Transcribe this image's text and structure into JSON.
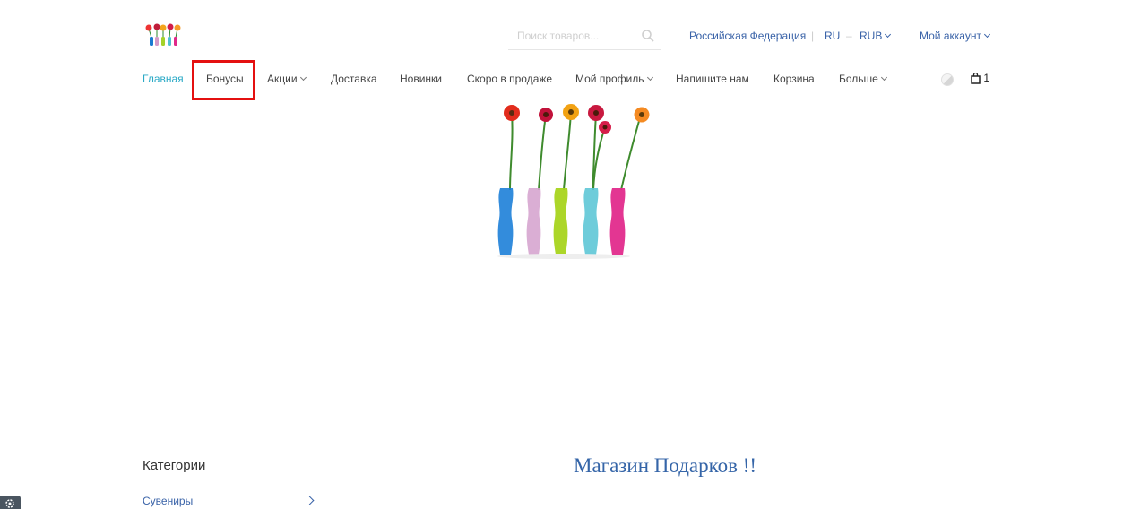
{
  "logo": {
    "icon": "flower-vases-logo-icon"
  },
  "search": {
    "placeholder": "Поиск товаров..."
  },
  "topnav": {
    "region": "Российская Федерация",
    "separator": "|",
    "language": "RU",
    "dash": "–",
    "currency": "RUB",
    "account": "Мой аккаунт"
  },
  "mainnav": {
    "items": [
      {
        "label": "Главная",
        "active": true
      },
      {
        "label": "Бонусы"
      },
      {
        "label": "Акции",
        "dropdown": true
      },
      {
        "label": "Доставка"
      },
      {
        "label": "Новинки"
      },
      {
        "label": "Скоро в продаже"
      },
      {
        "label": "Мой профиль",
        "dropdown": true
      },
      {
        "label": "Напишите нам"
      },
      {
        "label": "Корзина"
      },
      {
        "label": "Больше",
        "dropdown": true
      }
    ]
  },
  "cart": {
    "count": "1",
    "icon": "shopping-bag-icon"
  },
  "colors": {
    "accent": "#2aa9c6",
    "link": "#3a63a8",
    "highlight": "#e41010",
    "title": "#3565a8"
  },
  "categories": {
    "title": "Категории",
    "items": [
      {
        "label": "Сувениры"
      }
    ]
  },
  "main": {
    "title": "Магазин Подарков !!"
  }
}
